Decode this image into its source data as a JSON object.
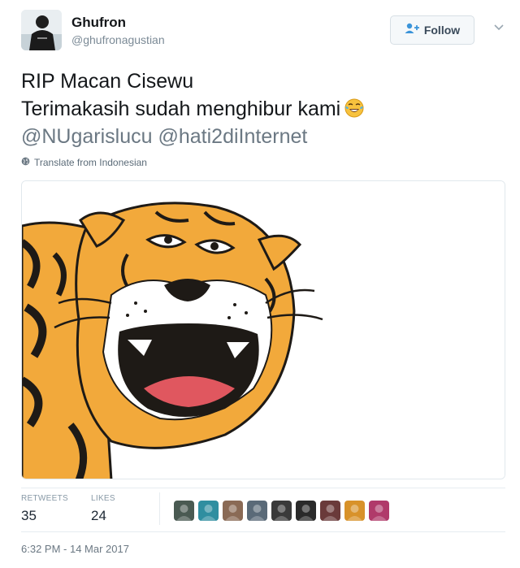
{
  "author": {
    "name": "Ghufron",
    "handle": "@ghufronagustian"
  },
  "follow_button": {
    "label": "Follow",
    "icon": "add-user-icon"
  },
  "tweet": {
    "line1": "RIP Macan Cisewu",
    "line2": "Terimakasih sudah menghibur kami",
    "line2_emoji": "face-with-tears-of-joy",
    "mentions": [
      "@NUgarislucu",
      "@hati2diInternet"
    ]
  },
  "translate": {
    "label": "Translate from Indonesian",
    "icon": "globe-icon"
  },
  "stats": {
    "retweets_label": "RETWEETS",
    "retweets_value": "35",
    "likes_label": "LIKES",
    "likes_value": "24"
  },
  "likers": [
    {
      "color": "#4a5a52"
    },
    {
      "color": "#2f8ea0"
    },
    {
      "color": "#8a6a55"
    },
    {
      "color": "#5a6a78"
    },
    {
      "color": "#3a3a3a"
    },
    {
      "color": "#2a2a2a"
    },
    {
      "color": "#6a3a3a"
    },
    {
      "color": "#d8922a"
    },
    {
      "color": "#b03a6a"
    }
  ],
  "timestamp": "6:32 PM - 14 Mar 2017",
  "colors": {
    "tiger_orange": "#f2a93b",
    "tiger_stripe": "#1e1a16",
    "mouth_red": "#e0575f"
  }
}
